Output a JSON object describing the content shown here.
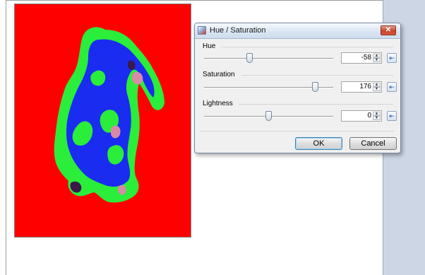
{
  "dialog": {
    "title": "Hue / Saturation",
    "close_glyph": "✕",
    "ok_label": "OK",
    "cancel_label": "Cancel"
  },
  "adjustments": {
    "hue": {
      "label": "Hue",
      "value": "-58",
      "fraction": 0.35
    },
    "saturation": {
      "label": "Saturation",
      "value": "176",
      "fraction": 0.86
    },
    "lightness": {
      "label": "Lightness",
      "value": "0",
      "fraction": 0.5
    }
  },
  "icons": {
    "dialog": "hue-saturation-icon",
    "spin_up": "▲",
    "spin_down": "▼",
    "reset": "⇤"
  },
  "colors": {
    "image_background": "#ff0000",
    "image_fill_blue": "#1a2cf0",
    "image_fill_green": "#2aee3a",
    "side_panel": "#ccd6e5"
  }
}
